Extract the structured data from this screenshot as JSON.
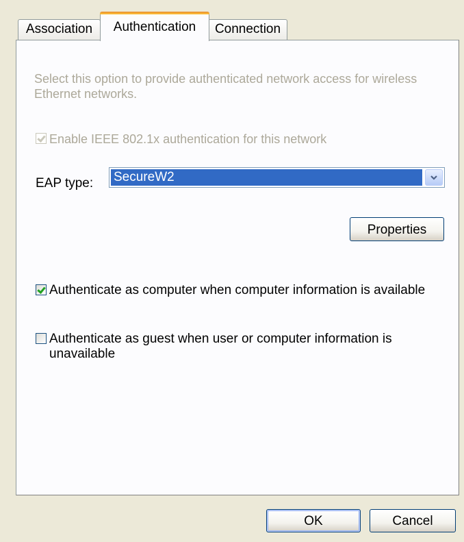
{
  "tabs": [
    {
      "label": "Association",
      "active": false
    },
    {
      "label": "Authentication",
      "active": true
    },
    {
      "label": "Connection",
      "active": false
    }
  ],
  "authentication": {
    "description": "Select this option to provide authenticated network access for wireless Ethernet networks.",
    "enable_8021x": {
      "label": "Enable IEEE 802.1x authentication for this network",
      "checked": true,
      "enabled": false
    },
    "eap_type_label": "EAP type:",
    "eap_type_value": "SecureW2",
    "properties_label": "Properties",
    "auth_as_computer": {
      "label": "Authenticate as computer when computer information is available",
      "checked": true
    },
    "auth_as_guest": {
      "label": "Authenticate as guest when user or computer information is unavailable",
      "checked": false
    }
  },
  "footer": {
    "ok_label": "OK",
    "cancel_label": "Cancel"
  },
  "colors": {
    "dialog_background": "#ECE9D8",
    "panel_background": "#FCFCFE",
    "selection": "#316AC5",
    "active_tab_accent": "#FFC73C",
    "disabled_text": "#ACA899"
  },
  "icons": {
    "dropdown": "chevron-down-icon",
    "checkmark": "checkmark-icon"
  }
}
